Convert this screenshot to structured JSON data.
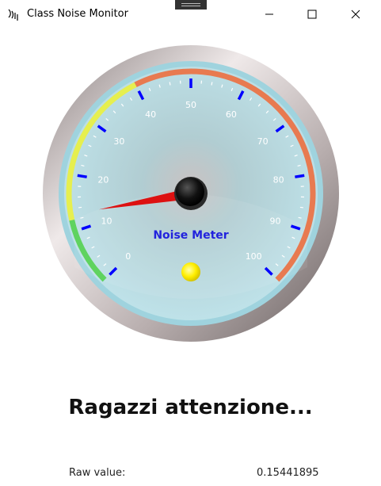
{
  "window": {
    "title": "Class Noise Monitor",
    "icon": "waveform-icon",
    "controls": [
      "minimize-icon",
      "maximize-icon",
      "close-icon"
    ]
  },
  "gauge": {
    "label": "Noise Meter",
    "min": 0,
    "max": 100,
    "ticks": [
      "0",
      "10",
      "20",
      "30",
      "40",
      "50",
      "60",
      "70",
      "80",
      "90",
      "100"
    ],
    "needle_value": 13,
    "bands": [
      {
        "from": 0,
        "to": 12,
        "color": "#5fd35f"
      },
      {
        "from": 12,
        "to": 40,
        "color": "#e6ef4f"
      },
      {
        "from": 40,
        "to": 100,
        "color": "#e87a50"
      }
    ],
    "indicator_color": "#ffee00",
    "tick_color": "#0000ff",
    "label_color": "#2222dd",
    "needle_color": "#dd1111"
  },
  "message": "Ragazzi attenzione...",
  "raw": {
    "label": "Raw value:",
    "value": "0.15441895"
  }
}
